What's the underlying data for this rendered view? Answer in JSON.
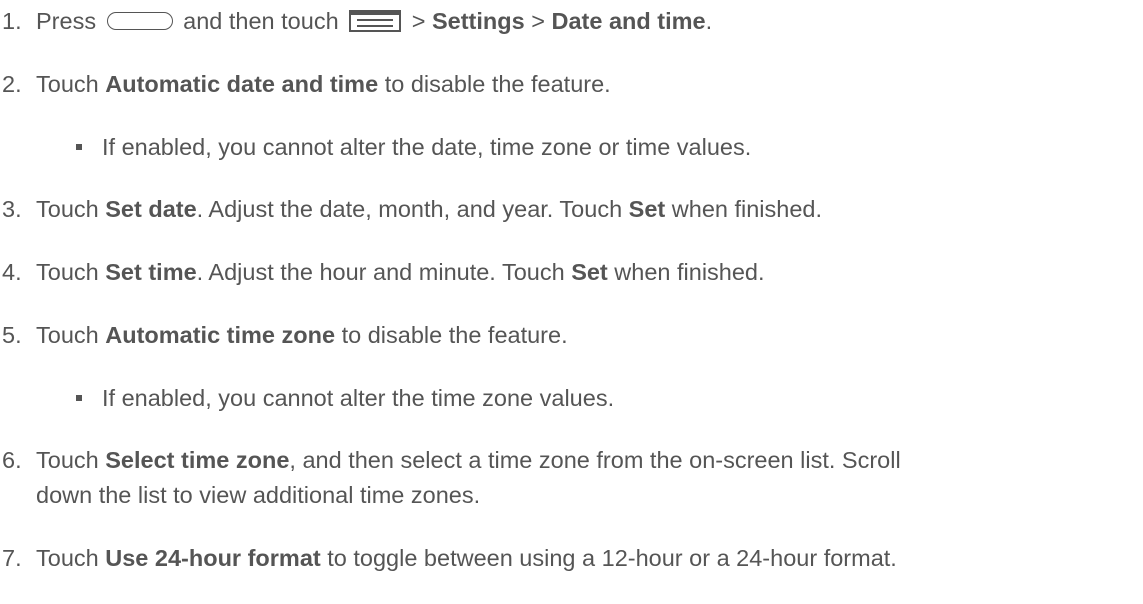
{
  "steps": [
    {
      "num": "1.",
      "press": "Press",
      "and_then_touch": "and then touch",
      "sep1": ">",
      "settings": "Settings",
      "sep2": ">",
      "date_and_time": "Date and time",
      "end": ".",
      "icons": [
        "home-key-icon",
        "menu-key-icon"
      ]
    },
    {
      "num": "2.",
      "touch": "Touch",
      "bold": "Automatic date and time",
      "rest": "to disable the feature."
    },
    {
      "bullet": "If enabled, you cannot alter the date, time zone or time values."
    },
    {
      "num": "3.",
      "touch": "Touch",
      "bold": "Set date",
      "rest": ". Adjust the date, month, and year. Touch",
      "bold2": "Set",
      "rest2": "when finished."
    },
    {
      "num": "4.",
      "touch": "Touch",
      "bold": "Set time",
      "rest": ". Adjust the hour and minute. Touch",
      "bold2": "Set",
      "rest2": "when finished."
    },
    {
      "num": "5.",
      "touch": "Touch",
      "bold": "Automatic time zone",
      "rest": "to disable the feature."
    },
    {
      "bullet": "If enabled, you cannot alter the time zone values."
    },
    {
      "num": "6.",
      "touch": "Touch",
      "bold": "Select time zone",
      "rest": ", and then select a time zone from the on-screen list. Scroll",
      "line2": "down the list to view additional time zones."
    },
    {
      "num": "7.",
      "touch": "Touch",
      "bold": "Use 24-hour format",
      "rest": "to toggle between using a 12-hour or a 24-hour format."
    }
  ],
  "colors": {
    "text": "#555555",
    "background": "#ffffff"
  }
}
